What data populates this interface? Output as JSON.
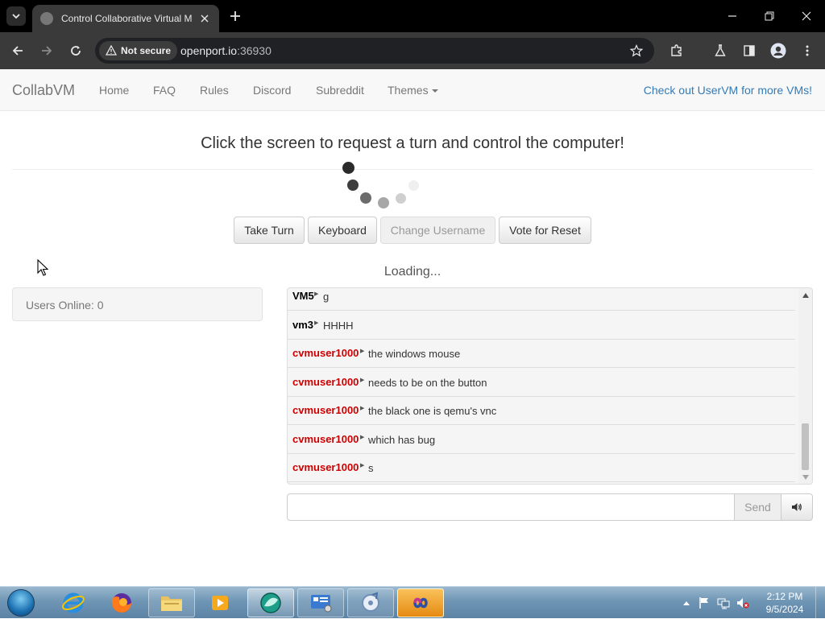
{
  "browser": {
    "tab_title": "Control Collaborative Virtual M",
    "security_label": "Not secure",
    "url_host": "openport.io",
    "url_port": ":36930"
  },
  "navbar": {
    "brand": "CollabVM",
    "links": [
      "Home",
      "FAQ",
      "Rules",
      "Discord",
      "Subreddit",
      "Themes"
    ],
    "right_link": "Check out UserVM for more VMs!"
  },
  "main": {
    "headline": "Click the screen to request a turn and control the computer!",
    "buttons": {
      "take_turn": "Take Turn",
      "keyboard": "Keyboard",
      "change_username": "Change Username",
      "vote_reset": "Vote for Reset"
    },
    "loading": "Loading..."
  },
  "users_online": "Users Online: 0",
  "chat": {
    "messages": [
      {
        "user": "VM5",
        "text": "g",
        "color": "#000000"
      },
      {
        "user": "vm3",
        "text": "HHHH",
        "color": "#000000"
      },
      {
        "user": "cvmuser1000",
        "text": "the windows mouse",
        "color": "#cc0000"
      },
      {
        "user": "cvmuser1000",
        "text": "needs to be on the button",
        "color": "#cc0000"
      },
      {
        "user": "cvmuser1000",
        "text": "the black one is qemu's vnc",
        "color": "#cc0000"
      },
      {
        "user": "cvmuser1000",
        "text": "which has bug",
        "color": "#cc0000"
      },
      {
        "user": "cvmuser1000",
        "text": "s",
        "color": "#cc0000"
      }
    ],
    "input_value": "",
    "send_label": "Send",
    "scroll_position": 0.95
  },
  "taskbar": {
    "apps": [
      "internet-explorer-icon",
      "firefox-icon",
      "file-explorer-icon",
      "media-player-icon",
      "collabvm-app-icon",
      "control-panel-icon",
      "media-center-icon",
      "infinity-app-icon"
    ],
    "clock_time": "2:12 PM",
    "clock_date": "9/5/2024"
  },
  "colors": {
    "link": "#337ab7",
    "admin_user": "#cc0000",
    "navbar_bg": "#f8f8f8"
  }
}
